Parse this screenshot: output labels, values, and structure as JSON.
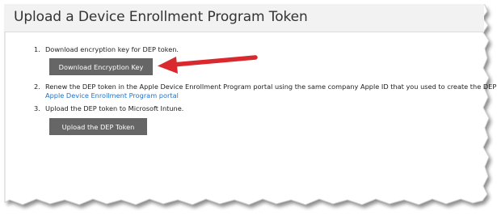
{
  "header": {
    "title": "Upload a Device Enrollment Program Token"
  },
  "steps": [
    {
      "number": "1.",
      "text": "Download encryption key for DEP token.",
      "button_label": "Download Encryption Key"
    },
    {
      "number": "2.",
      "text": "Renew the DEP token in the Apple Device Enrollment Program portal using the same company Apple ID that you used to create the DEP token.",
      "link_label": "Apple Device Enrollment Program portal"
    },
    {
      "number": "3.",
      "text": "Upload the DEP token to Microsoft Intune.",
      "button_label": "Upload the DEP Token"
    }
  ],
  "colors": {
    "button_bg": "#666666",
    "link": "#1e72c8",
    "annotation_arrow": "#d9282e"
  },
  "annotation": {
    "icon": "red-arrow-icon",
    "points_to": "Download Encryption Key"
  }
}
